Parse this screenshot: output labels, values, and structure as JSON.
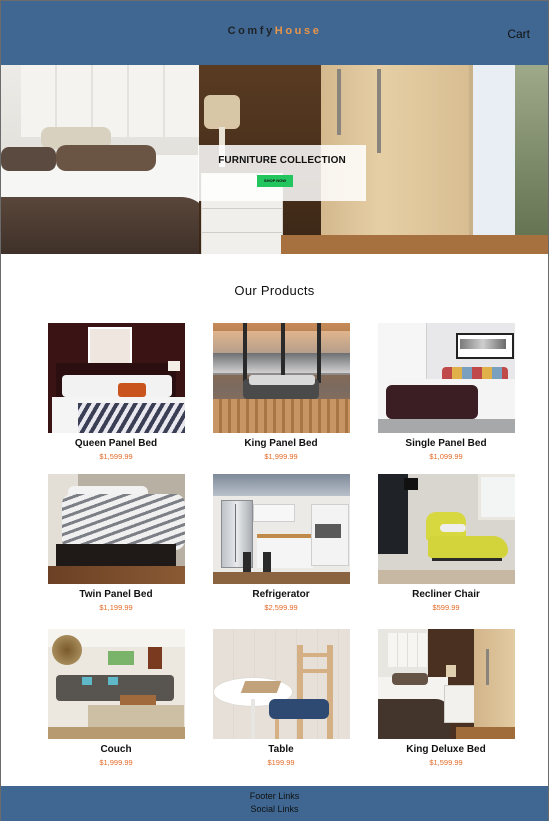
{
  "navbar": {
    "logo_part1": "Comfy",
    "logo_part2": "House",
    "cart_label": "Cart",
    "colors": {
      "bar": "#3f6791",
      "logo_accent": "#e8954a"
    }
  },
  "hero": {
    "title": "FURNITURE COLLECTION",
    "button_label": "SHOP NOW",
    "button_color": "#22c55e"
  },
  "products": {
    "title": "Our Products",
    "price_color": "#e36a28",
    "items": [
      {
        "name": "Queen Panel Bed",
        "price": "$1,599.99"
      },
      {
        "name": "King Panel Bed",
        "price": "$1,999.99"
      },
      {
        "name": "Single Panel Bed",
        "price": "$1,099.99"
      },
      {
        "name": "Twin Panel Bed",
        "price": "$1,199.99"
      },
      {
        "name": "Refrigerator",
        "price": "$2,599.99"
      },
      {
        "name": "Recliner Chair",
        "price": "$599.99"
      },
      {
        "name": "Couch",
        "price": "$1,999.99"
      },
      {
        "name": "Table",
        "price": "$199.99"
      },
      {
        "name": "King Deluxe Bed",
        "price": "$1,599.99"
      }
    ]
  },
  "footer": {
    "line1": "Footer Links",
    "line2": "Social Links"
  }
}
